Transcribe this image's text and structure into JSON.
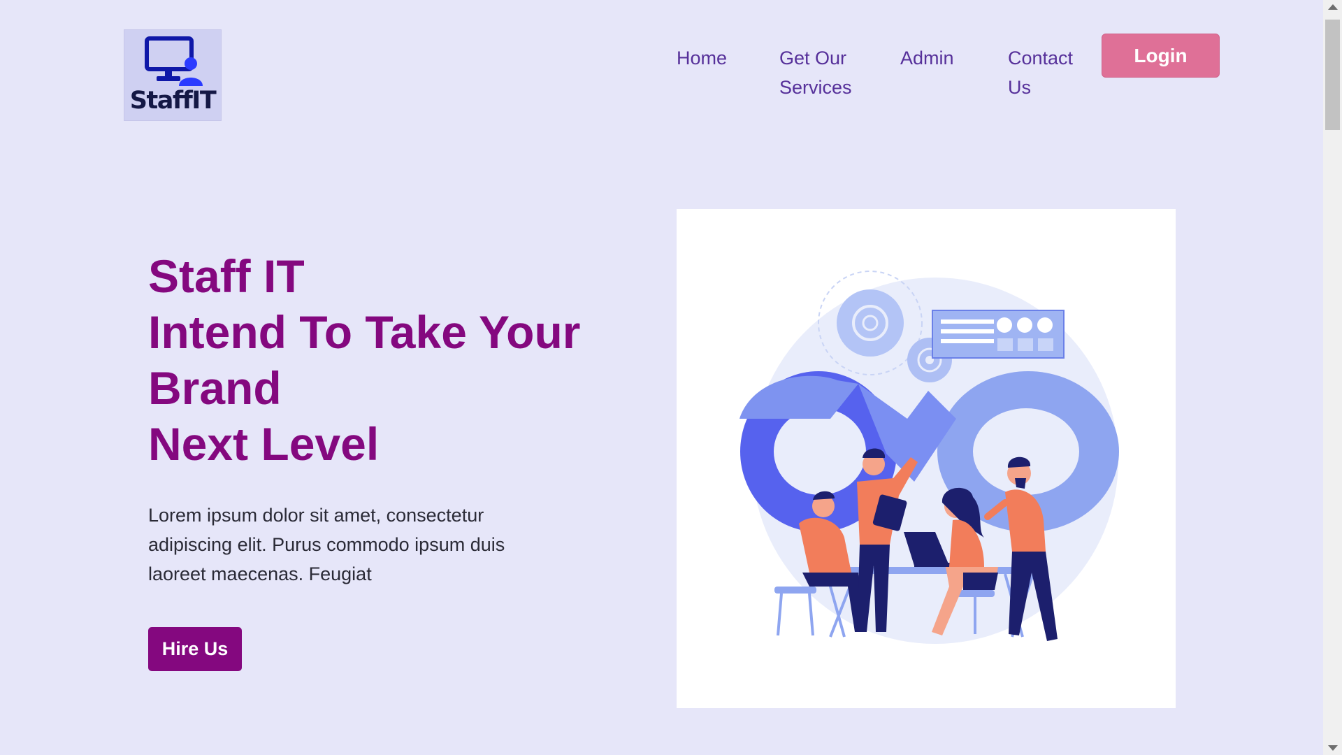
{
  "brand": {
    "logo_text": "StaffIT",
    "icon": "monitor-user-icon"
  },
  "nav": {
    "home": "Home",
    "services": "Get Our Services",
    "admin": "Admin",
    "contact": "Contact Us",
    "login": "Login"
  },
  "hero": {
    "title_line1": "Staff IT",
    "title_line2": "Intend To Take Your",
    "title_line3": "Brand",
    "title_line4": "Next Level",
    "description": "Lorem ipsum dolor sit amet, consectetur adipiscing elit. Purus commodo ipsum duis laoreet maecenas. Feugiat",
    "cta": "Hire Us"
  },
  "illustration": {
    "icon": "teamwork-infinity-illustration"
  },
  "colors": {
    "background": "#e6e6f9",
    "primary_purple": "#84087f",
    "nav_text": "#56309a",
    "login_pink": "#df7097"
  }
}
